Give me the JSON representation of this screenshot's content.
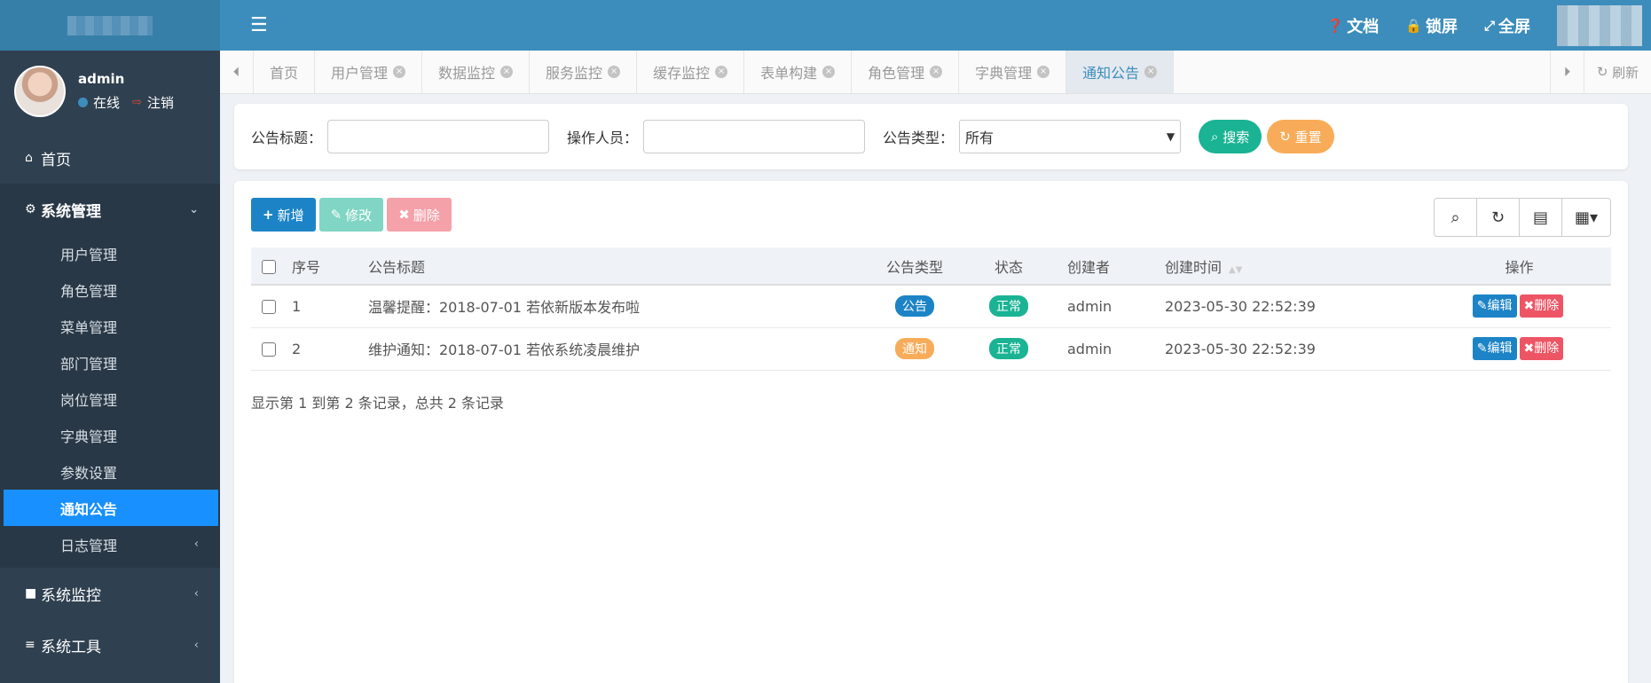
{
  "sidebar": {
    "user": {
      "name": "admin",
      "status": "在线",
      "logout": "注销"
    },
    "menu": [
      {
        "label": "首页",
        "icon": "home-icon"
      },
      {
        "label": "系统管理",
        "icon": "gear-icon"
      },
      {
        "label": "系统监控",
        "icon": "video-icon"
      },
      {
        "label": "系统工具",
        "icon": "bars-icon"
      }
    ],
    "submenu": [
      "用户管理",
      "角色管理",
      "菜单管理",
      "部门管理",
      "岗位管理",
      "字典管理",
      "参数设置",
      "通知公告",
      "日志管理"
    ]
  },
  "header": {
    "doc": "文档",
    "lock": "锁屏",
    "fullscreen": "全屏"
  },
  "tabs": {
    "items": [
      "首页",
      "用户管理",
      "数据监控",
      "服务监控",
      "缓存监控",
      "表单构建",
      "角色管理",
      "字典管理",
      "通知公告"
    ],
    "refresh": "刷新"
  },
  "search": {
    "title_label": "公告标题：",
    "operator_label": "操作人员：",
    "type_label": "公告类型：",
    "type_value": "所有",
    "search_btn": "搜索",
    "reset_btn": "重置"
  },
  "toolbar": {
    "add": "新增",
    "edit": "修改",
    "delete": "删除"
  },
  "table": {
    "headers": [
      "序号",
      "公告标题",
      "公告类型",
      "状态",
      "创建者",
      "创建时间",
      "操作"
    ],
    "rows": [
      {
        "id": "1",
        "title": "温馨提醒：2018-07-01 若依新版本发布啦",
        "type": "公告",
        "status": "正常",
        "creator": "admin",
        "time": "2023-05-30 22:52:39"
      },
      {
        "id": "2",
        "title": "维护通知：2018-07-01 若依系统凌晨维护",
        "type": "通知",
        "status": "正常",
        "creator": "admin",
        "time": "2023-05-30 22:52:39"
      }
    ],
    "edit_label": "编辑",
    "delete_label": "删除",
    "footer": "显示第 1 到第 2 条记录，总共 2 条记录"
  }
}
